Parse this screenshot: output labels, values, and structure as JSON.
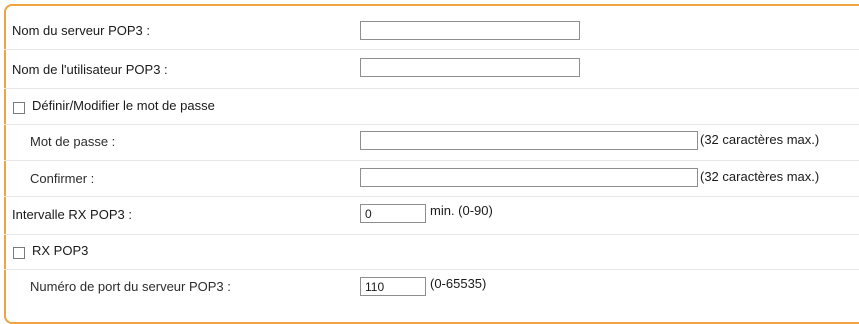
{
  "form": {
    "pop3_server_name": {
      "label": "Nom du serveur POP3 :",
      "value": ""
    },
    "pop3_user_name": {
      "label": "Nom de l'utilisateur POP3 :",
      "value": ""
    },
    "set_change_password": {
      "label": "Définir/Modifier le mot de passe",
      "checked": false
    },
    "password": {
      "label": "Mot de passe :",
      "value": "",
      "hint": "(32 caractères max.)"
    },
    "confirm": {
      "label": "Confirmer :",
      "value": "",
      "hint": "(32 caractères max.)"
    },
    "pop3_rx_interval": {
      "label": "Intervalle RX POP3 :",
      "value": "0",
      "hint": "min. (0-90)"
    },
    "rx_pop3": {
      "label": "RX POP3",
      "checked": false
    },
    "pop3_port": {
      "label": "Numéro de port du serveur POP3 :",
      "value": "110",
      "hint": "(0-65535)"
    }
  },
  "colors": {
    "panel_border": "#f0a340"
  }
}
